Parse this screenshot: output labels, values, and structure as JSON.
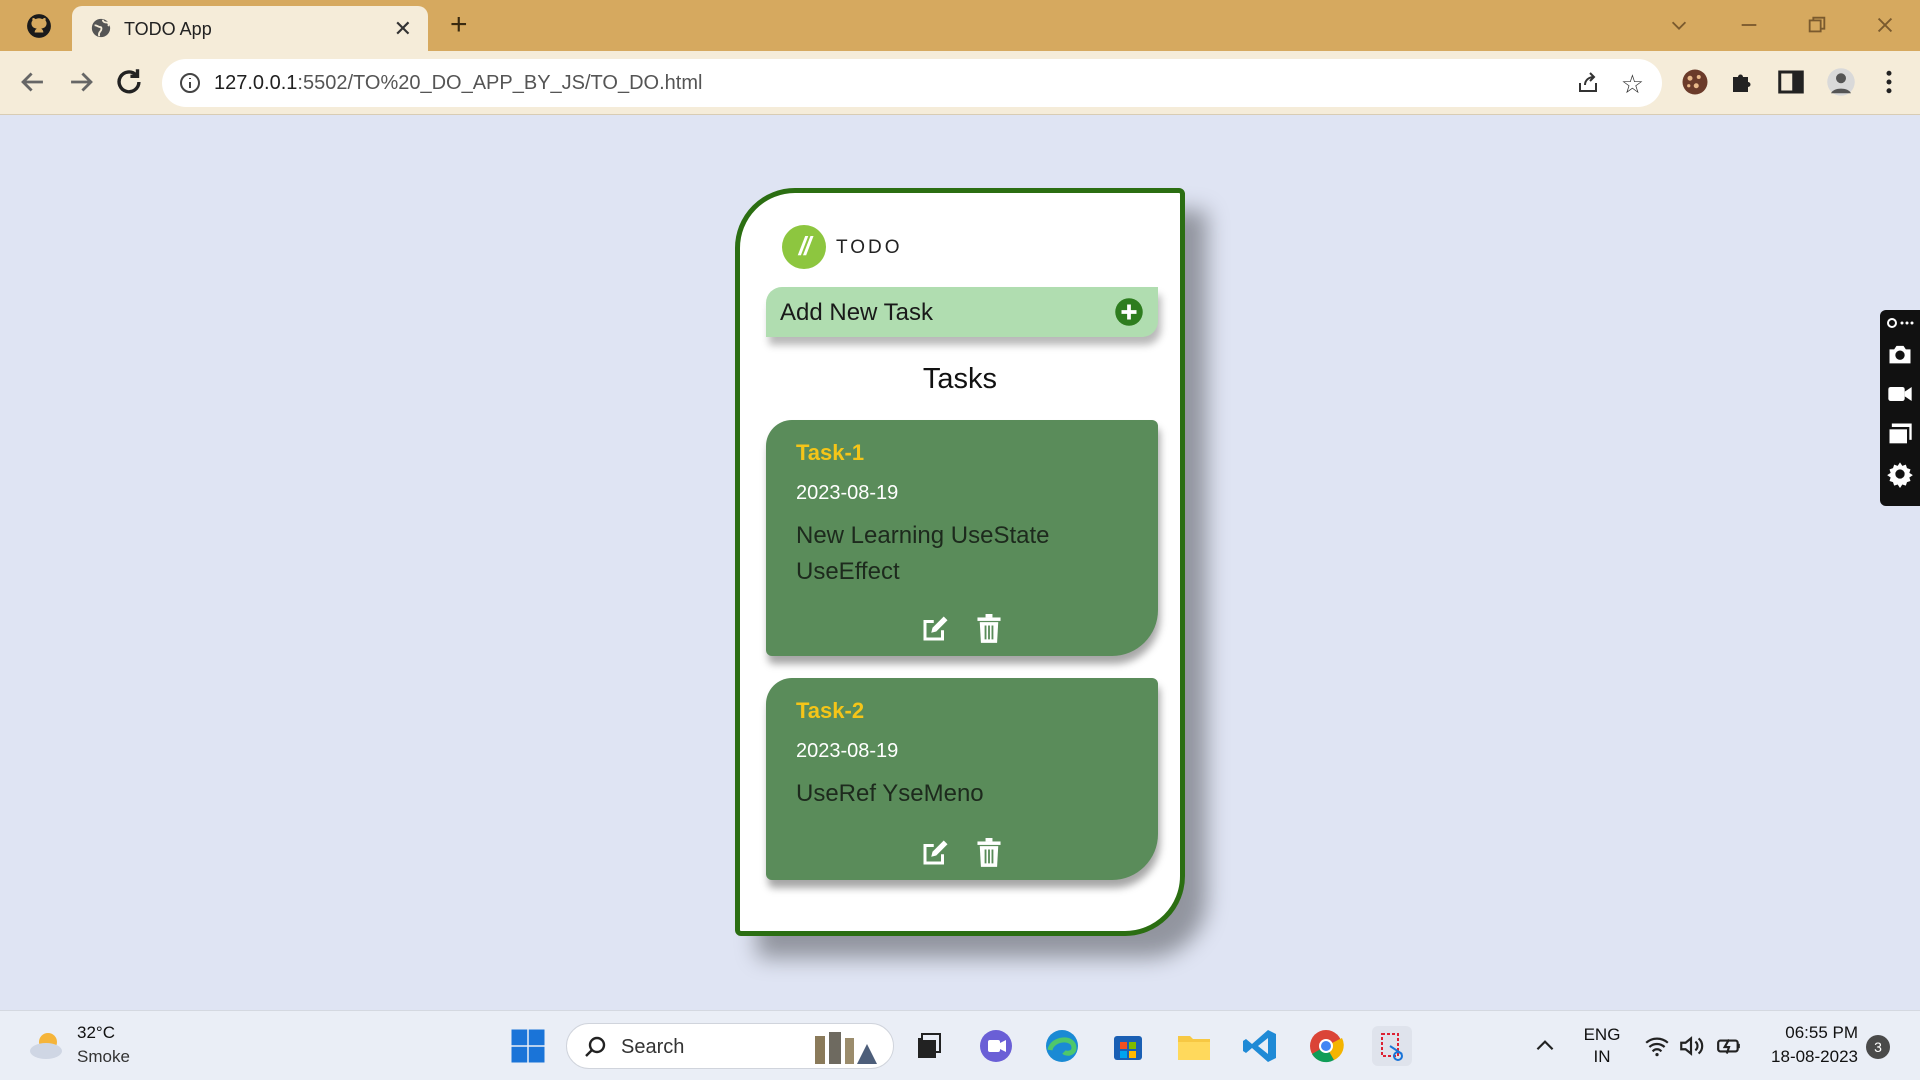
{
  "browser": {
    "tab_title": "TODO App",
    "tab_close": "✕",
    "new_tab": "+",
    "url_host": "127.0.0.1",
    "url_rest": ":5502/TO%20_DO_APP_BY_JS/TO_DO.html"
  },
  "app": {
    "logo_mark": "//",
    "logo_text": "TODO",
    "add_task_label": "Add New Task",
    "tasks_heading": "Tasks",
    "tasks": [
      {
        "name": "Task-1",
        "date": "2023-08-19",
        "description": "New Learning UseState UseEffect"
      },
      {
        "name": "Task-2",
        "date": "2023-08-19",
        "description": "UseRef YseMeno"
      }
    ]
  },
  "taskbar": {
    "temperature": "32°C",
    "condition": "Smoke",
    "search_label": "Search",
    "lang_top": "ENG",
    "lang_bottom": "IN",
    "time": "06:55 PM",
    "date": "18-08-2023",
    "notification_count": "3"
  },
  "colors": {
    "tabbar": "#d6a95f",
    "page_bg": "#dfe4f3",
    "card_border": "#2b6e12",
    "task_card": "#5a8c5a",
    "task_name": "#f5c518",
    "add_task_bg": "#b0ddb0"
  }
}
